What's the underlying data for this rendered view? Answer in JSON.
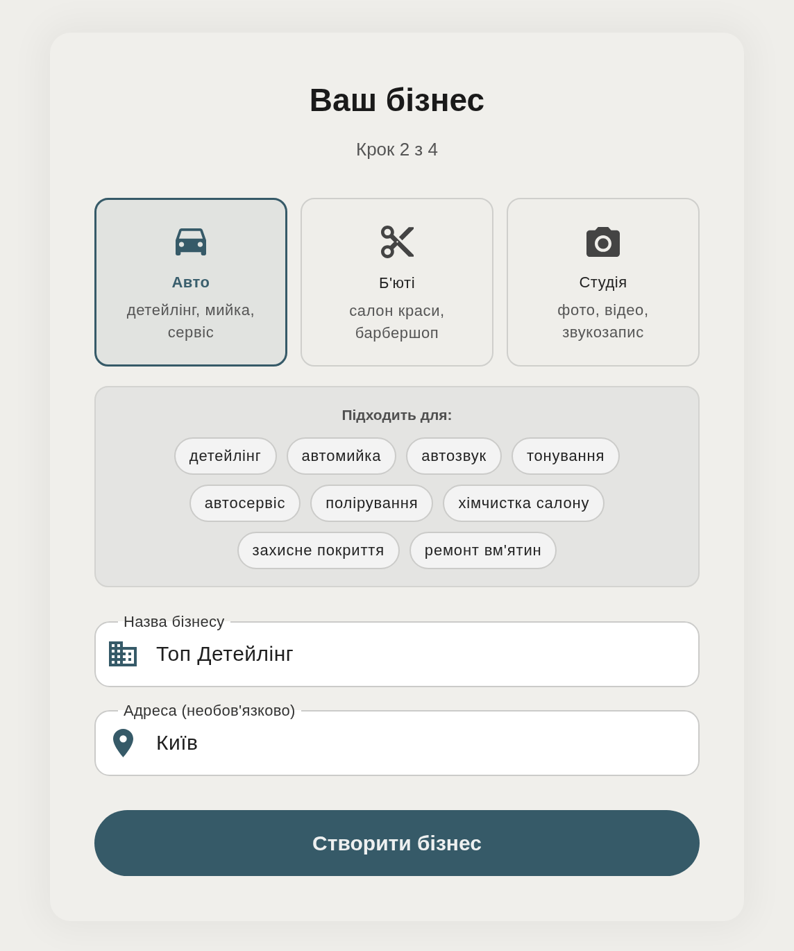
{
  "header": {
    "title": "Ваш бізнес",
    "step": "Крок 2 з 4"
  },
  "categories": [
    {
      "kind": "car",
      "title": "Авто",
      "description": "детейлінг, мийка, сервіс",
      "selected": true
    },
    {
      "kind": "scissors",
      "title": "Б'юті",
      "description": "салон краси, барбершоп",
      "selected": false
    },
    {
      "kind": "camera",
      "title": "Студія",
      "description": "фото, відео, звукозапис",
      "selected": false
    }
  ],
  "suggestions": {
    "heading": "Підходить для:",
    "tags": [
      "детейлінг",
      "автомийка",
      "автозвук",
      "тонування",
      "автосервіс",
      "полірування",
      "хімчистка салону",
      "захисне покриття",
      "ремонт вм'ятин"
    ]
  },
  "fields": [
    {
      "kind": "building",
      "label": "Назва бізнесу",
      "value": "Топ Детейлінг"
    },
    {
      "kind": "pin",
      "label": "Адреса (необов'язково)",
      "value": "Київ"
    }
  ],
  "submit": {
    "label": "Створити бізнес"
  }
}
